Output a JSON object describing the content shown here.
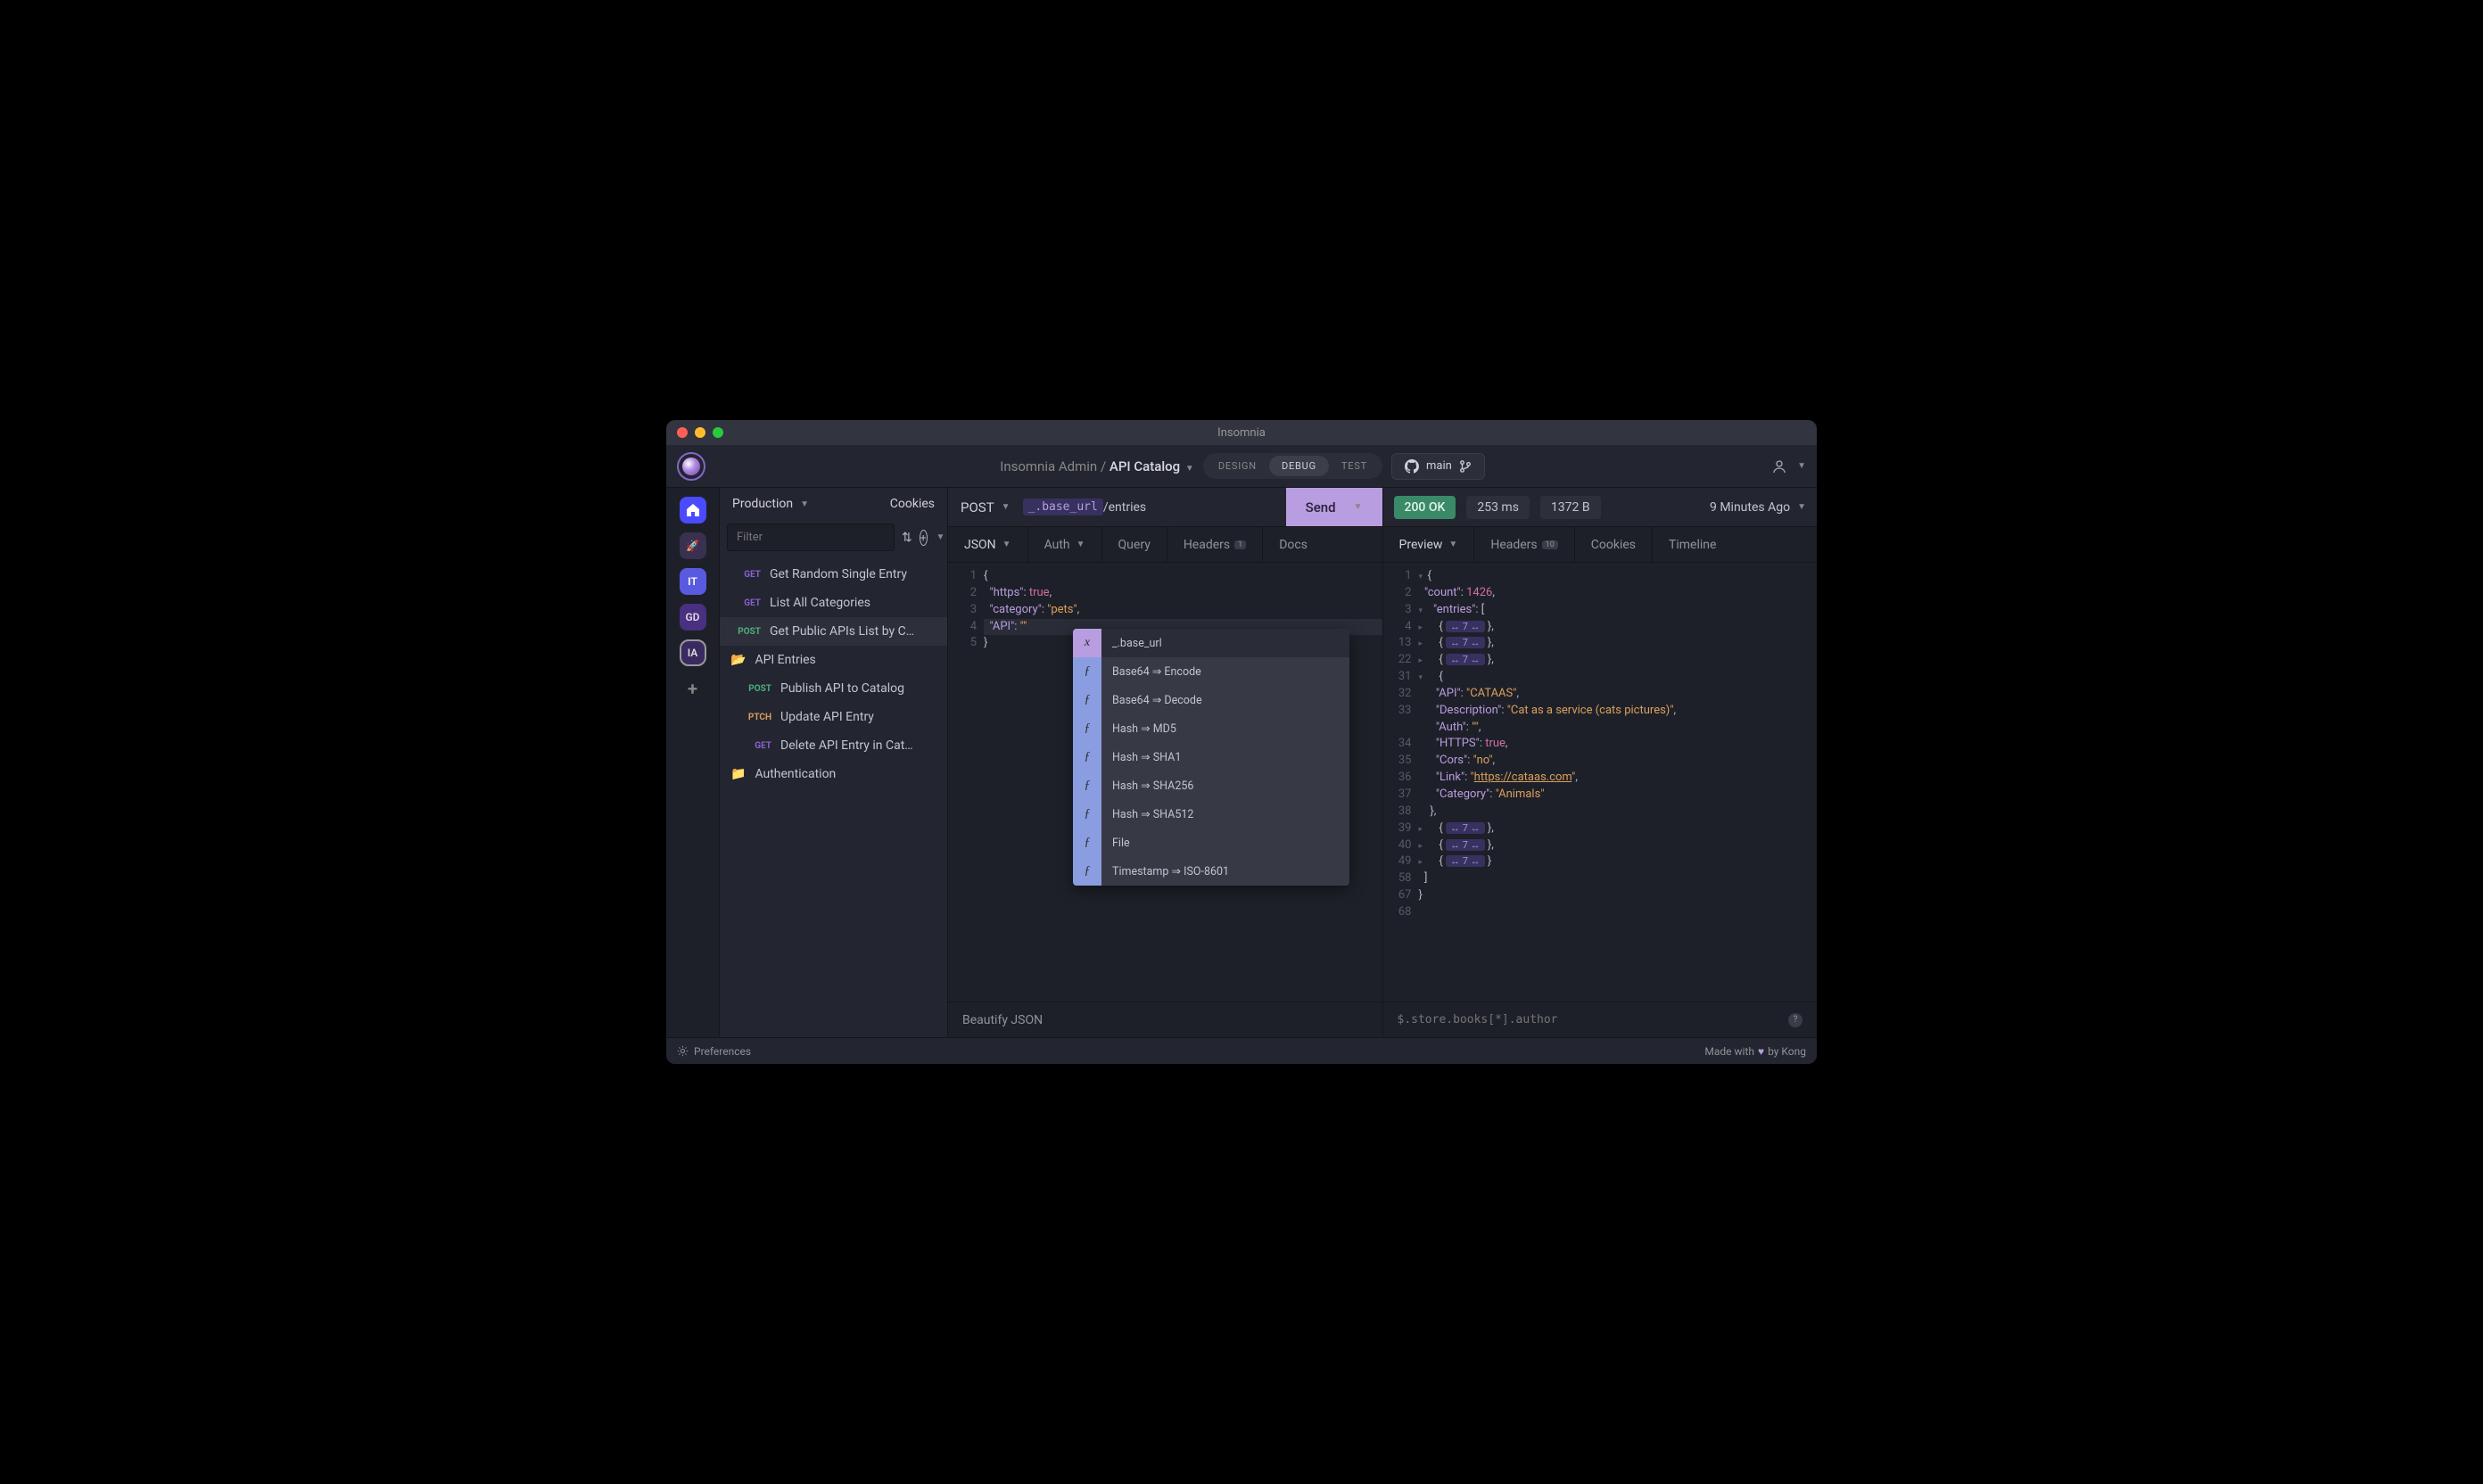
{
  "window": {
    "title": "Insomnia"
  },
  "header": {
    "breadcrumb_workspace": "Insomnia Admin",
    "breadcrumb_sep": "/",
    "breadcrumb_collection": "API Catalog",
    "segments": {
      "design": "DESIGN",
      "debug": "DEBUG",
      "test": "TEST"
    },
    "git_branch": "main"
  },
  "rail": {
    "it": "IT",
    "gd": "GD",
    "ia": "IA"
  },
  "sidebar": {
    "env": "Production",
    "cookies": "Cookies",
    "filter_placeholder": "Filter",
    "items": [
      {
        "method": "GET",
        "label": "Get Random Single Entry"
      },
      {
        "method": "GET",
        "label": "List All Categories"
      },
      {
        "method": "POST",
        "label": "Get Public APIs List by C…"
      }
    ],
    "folder1": "API Entries",
    "folder1_items": [
      {
        "method": "POST",
        "label": "Publish API to Catalog"
      },
      {
        "method": "PTCH",
        "label": "Update API Entry"
      },
      {
        "method": "GET",
        "label": "Delete API Entry in Cat…"
      }
    ],
    "folder2": "Authentication"
  },
  "request": {
    "method": "POST",
    "url_tag": "_.base_url",
    "url_path": "/entries",
    "send": "Send",
    "tabs": {
      "json": "JSON",
      "auth": "Auth",
      "query": "Query",
      "headers": "Headers",
      "headers_count": "1",
      "docs": "Docs"
    },
    "editor_lines": [
      "1",
      "2",
      "3",
      "4",
      "5"
    ],
    "beautify": "Beautify JSON"
  },
  "autocomplete": {
    "items": [
      {
        "kind": "x",
        "label": "_.base_url",
        "sel": true
      },
      {
        "kind": "ƒ",
        "label": "Base64 ⇒ Encode"
      },
      {
        "kind": "ƒ",
        "label": "Base64 ⇒ Decode"
      },
      {
        "kind": "ƒ",
        "label": "Hash ⇒ MD5"
      },
      {
        "kind": "ƒ",
        "label": "Hash ⇒ SHA1"
      },
      {
        "kind": "ƒ",
        "label": "Hash ⇒ SHA256"
      },
      {
        "kind": "ƒ",
        "label": "Hash ⇒ SHA512"
      },
      {
        "kind": "ƒ",
        "label": "File"
      },
      {
        "kind": "ƒ",
        "label": "Timestamp ⇒ ISO-8601"
      }
    ]
  },
  "response": {
    "status": "200 OK",
    "time": "253 ms",
    "size": "1372 B",
    "ago": "9 Minutes Ago",
    "tabs": {
      "preview": "Preview",
      "headers": "Headers",
      "headers_count": "10",
      "cookies": "Cookies",
      "timeline": "Timeline"
    },
    "filter_placeholder": "$.store.books[*].author",
    "body": {
      "count": 1426,
      "entry": {
        "API": "CATAAS",
        "Description": "Cat as a service (cats pictures)",
        "Auth": "",
        "HTTPS": true,
        "Cors": "no",
        "Link": "https://cataas.com",
        "Category": "Animals"
      }
    },
    "gutter": [
      "1",
      "2",
      "3",
      "4",
      "13",
      "22",
      "31",
      "32",
      "33",
      "",
      "34",
      "35",
      "36",
      "37",
      "38",
      "39",
      "40",
      "49",
      "58",
      "67",
      "68"
    ]
  },
  "request_body": {
    "https": true,
    "category": "pets",
    "API": ""
  },
  "footer": {
    "prefs": "Preferences",
    "made": "Made with",
    "by": "by Kong"
  }
}
